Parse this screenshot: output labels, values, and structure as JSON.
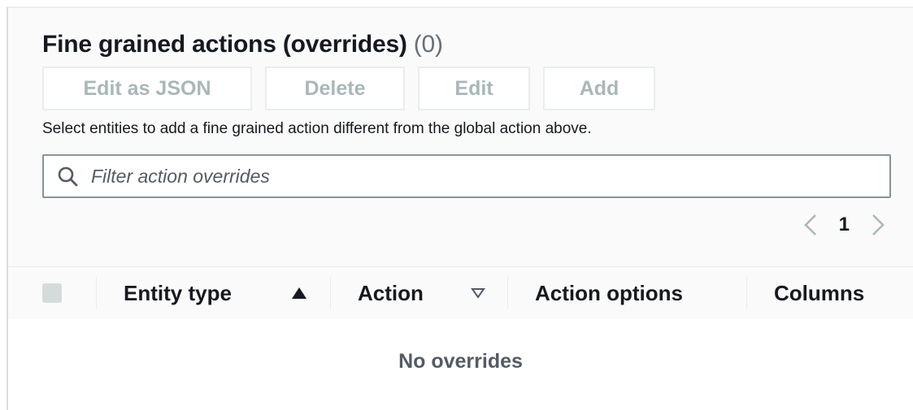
{
  "section": {
    "title": "Fine grained actions (overrides)",
    "count": "(0)",
    "description": "Select entities to add a fine grained action different from the global action above."
  },
  "toolbar": {
    "edit_json_label": "Edit as JSON",
    "delete_label": "Delete",
    "edit_label": "Edit",
    "add_label": "Add"
  },
  "filter": {
    "placeholder": "Filter action overrides",
    "value": ""
  },
  "pagination": {
    "current_page": "1"
  },
  "table": {
    "columns": [
      "Entity type",
      "Action",
      "Action options",
      "Columns"
    ],
    "sort": {
      "column": "Entity type",
      "direction": "ascending"
    },
    "empty_message": "No overrides",
    "rows": []
  },
  "icons": {
    "search": "search-icon",
    "prev": "chevron-left-icon",
    "next": "chevron-right-icon",
    "sort_asc": "sort-ascending-icon",
    "sort_none": "sort-descending-outline-icon"
  },
  "colors": {
    "disabled_text": "#aab7b8",
    "text": "#16191f",
    "muted": "#545b64",
    "border": "#879596"
  }
}
